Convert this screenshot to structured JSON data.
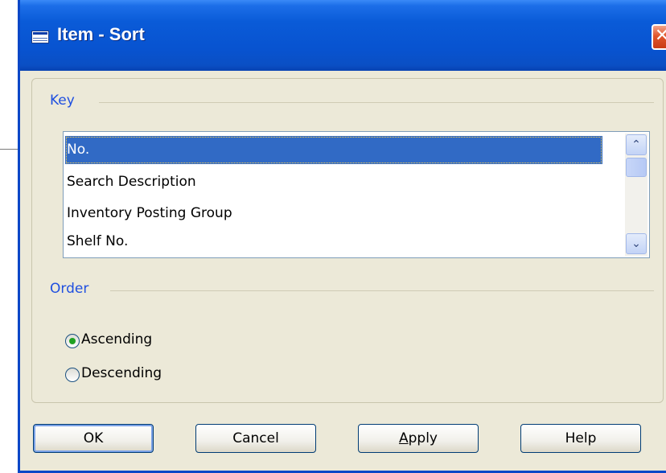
{
  "window": {
    "title": "Item - Sort"
  },
  "key_group": {
    "label": "Key",
    "items": [
      {
        "label": "No.",
        "selected": true
      },
      {
        "label": "Search Description",
        "selected": false
      },
      {
        "label": "Inventory Posting Group",
        "selected": false
      },
      {
        "label": "Shelf No.",
        "selected": false
      }
    ]
  },
  "order_group": {
    "label": "Order",
    "options": [
      {
        "label": "Ascending",
        "checked": true
      },
      {
        "label": "Descending",
        "checked": false
      }
    ]
  },
  "buttons": {
    "ok": "OK",
    "cancel": "Cancel",
    "apply": "Apply",
    "apply_accel": "A",
    "apply_rest": "pply",
    "help": "Help"
  },
  "icons": {
    "title": "table-icon",
    "close": "close-icon",
    "scroll_up": "chevron-up-icon",
    "scroll_down": "chevron-down-icon"
  },
  "colors": {
    "titlebar": "#0a5bd8",
    "selection": "#316ac5",
    "group_label": "#1f4fe0",
    "close": "#e0562c",
    "radio_dot": "#21a121"
  }
}
